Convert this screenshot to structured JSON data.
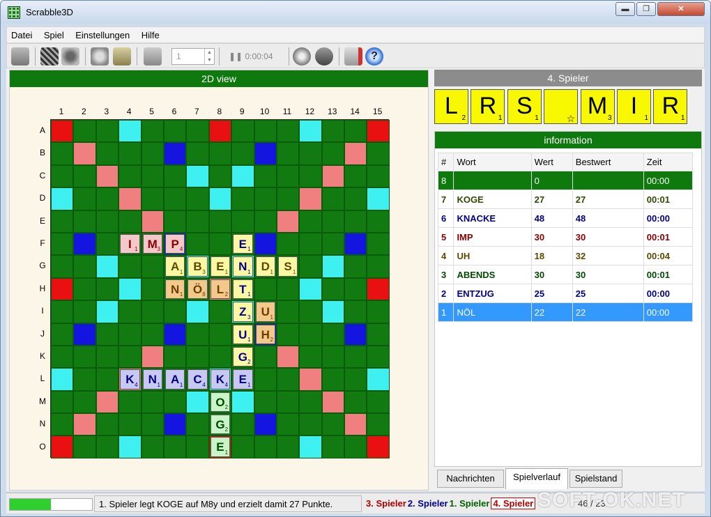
{
  "window": {
    "title": "Scrabble3D",
    "min_label": "▬",
    "max_label": "❐",
    "close_label": "✕"
  },
  "menu": [
    "Datei",
    "Spiel",
    "Einstellungen",
    "Hilfe"
  ],
  "toolbar": {
    "spin_value": "1",
    "timer": "0:00:04",
    "pause_label": "❚❚",
    "icons": [
      "exit-icon",
      "new-game-icon",
      "players-icon",
      "refresh-icon",
      "bag-icon",
      "player-badge-icon",
      "pause-icon",
      "network-icon",
      "network-disconnect-icon",
      "rules-icon",
      "help-icon"
    ]
  },
  "board": {
    "header": "2D view",
    "columns": [
      "1",
      "2",
      "3",
      "4",
      "5",
      "6",
      "7",
      "8",
      "9",
      "10",
      "11",
      "12",
      "13",
      "14",
      "15"
    ],
    "rows": [
      "A",
      "B",
      "C",
      "D",
      "E",
      "F",
      "G",
      "H",
      "I",
      "J",
      "K",
      "L",
      "M",
      "N",
      "O"
    ],
    "tiles": [
      {
        "row": 5,
        "col": 3,
        "letter": "I",
        "points": "1",
        "color": "pink"
      },
      {
        "row": 5,
        "col": 4,
        "letter": "M",
        "points": "3",
        "color": "pink"
      },
      {
        "row": 5,
        "col": 5,
        "letter": "P",
        "points": "4",
        "color": "pink"
      },
      {
        "row": 5,
        "col": 8,
        "letter": "E",
        "points": "1",
        "color": "yellow2"
      },
      {
        "row": 6,
        "col": 5,
        "letter": "A",
        "points": "1",
        "color": "yellow"
      },
      {
        "row": 6,
        "col": 6,
        "letter": "B",
        "points": "3",
        "color": "yellow"
      },
      {
        "row": 6,
        "col": 7,
        "letter": "E",
        "points": "1",
        "color": "yellow"
      },
      {
        "row": 6,
        "col": 8,
        "letter": "N",
        "points": "1",
        "color": "yellow2"
      },
      {
        "row": 6,
        "col": 9,
        "letter": "D",
        "points": "1",
        "color": "yellow"
      },
      {
        "row": 6,
        "col": 10,
        "letter": "S",
        "points": "1",
        "color": "yellow"
      },
      {
        "row": 7,
        "col": 5,
        "letter": "N",
        "points": "1",
        "color": "orange"
      },
      {
        "row": 7,
        "col": 6,
        "letter": "Ö",
        "points": "8",
        "color": "orange"
      },
      {
        "row": 7,
        "col": 7,
        "letter": "L",
        "points": "2",
        "color": "orange"
      },
      {
        "row": 7,
        "col": 8,
        "letter": "T",
        "points": "1",
        "color": "yellow2"
      },
      {
        "row": 8,
        "col": 8,
        "letter": "Z",
        "points": "3",
        "color": "yellow2"
      },
      {
        "row": 8,
        "col": 9,
        "letter": "U",
        "points": "1",
        "color": "orange"
      },
      {
        "row": 9,
        "col": 8,
        "letter": "U",
        "points": "1",
        "color": "yellow2"
      },
      {
        "row": 9,
        "col": 9,
        "letter": "H",
        "points": "2",
        "color": "orange"
      },
      {
        "row": 10,
        "col": 8,
        "letter": "G",
        "points": "2",
        "color": "yellow2"
      },
      {
        "row": 11,
        "col": 3,
        "letter": "K",
        "points": "4",
        "color": "blue"
      },
      {
        "row": 11,
        "col": 4,
        "letter": "N",
        "points": "1",
        "color": "blue"
      },
      {
        "row": 11,
        "col": 5,
        "letter": "A",
        "points": "1",
        "color": "blue"
      },
      {
        "row": 11,
        "col": 6,
        "letter": "C",
        "points": "4",
        "color": "blue"
      },
      {
        "row": 11,
        "col": 7,
        "letter": "K",
        "points": "4",
        "color": "blue"
      },
      {
        "row": 11,
        "col": 8,
        "letter": "E",
        "points": "1",
        "color": "blue"
      },
      {
        "row": 12,
        "col": 7,
        "letter": "O",
        "points": "2",
        "color": "green"
      },
      {
        "row": 13,
        "col": 7,
        "letter": "G",
        "points": "2",
        "color": "green"
      },
      {
        "row": 14,
        "col": 7,
        "letter": "E",
        "points": "1",
        "color": "green"
      }
    ]
  },
  "rack": {
    "header": "4. Spieler",
    "tiles": [
      {
        "letter": "L",
        "points": "2"
      },
      {
        "letter": "R",
        "points": "1"
      },
      {
        "letter": "S",
        "points": "1"
      },
      {
        "letter": "",
        "points": "0"
      },
      {
        "letter": "M",
        "points": "3"
      },
      {
        "letter": "I",
        "points": "1"
      },
      {
        "letter": "R",
        "points": "1"
      }
    ]
  },
  "info": {
    "header": "information",
    "columns": [
      "#",
      "Wort",
      "Wert",
      "Bestwert",
      "Zeit"
    ],
    "rows": [
      {
        "n": "8",
        "word": "",
        "value": "0",
        "best": "",
        "time": "00:00"
      },
      {
        "n": "7",
        "word": "KOGE",
        "value": "27",
        "best": "27",
        "time": "00:01"
      },
      {
        "n": "6",
        "word": "KNACKE",
        "value": "48",
        "best": "48",
        "time": "00:00"
      },
      {
        "n": "5",
        "word": "IMP",
        "value": "30",
        "best": "30",
        "time": "00:01"
      },
      {
        "n": "4",
        "word": "UH",
        "value": "18",
        "best": "32",
        "time": "00:04"
      },
      {
        "n": "3",
        "word": "ABENDS",
        "value": "30",
        "best": "30",
        "time": "00:01"
      },
      {
        "n": "2",
        "word": "ENTZUG",
        "value": "25",
        "best": "25",
        "time": "00:00"
      },
      {
        "n": "1",
        "word": "NÖL",
        "value": "22",
        "best": "22",
        "time": "00:00"
      }
    ],
    "row_colors": [
      "#ffffff",
      "#2d4a00",
      "#000080",
      "#8a0000",
      "#5a4a00",
      "#004a00",
      "#000080",
      "#ffffff"
    ],
    "row_backgrounds": [
      "#0e7a0e",
      "#ffffff",
      "#ffffff",
      "#ffffff",
      "#ffffff",
      "#ffffff",
      "#ffffff",
      "#3399ff"
    ],
    "tabs": [
      "Nachrichten",
      "Spielverlauf",
      "Spielstand"
    ],
    "active_tab": "Spielverlauf"
  },
  "status": {
    "progress": 0.5,
    "message": "1. Spieler legt KOGE auf M8y und erzielt damit 27 Punkte.",
    "players": [
      {
        "label": "3. Spieler",
        "color": "#b00000"
      },
      {
        "label": "2. Spieler",
        "color": "#000090"
      },
      {
        "label": "1. Spieler",
        "color": "#006000"
      },
      {
        "label": "4. Spieler",
        "color": "#b00000"
      }
    ],
    "extra": "46 / 23"
  },
  "watermark": "SOFT-OK.NET"
}
